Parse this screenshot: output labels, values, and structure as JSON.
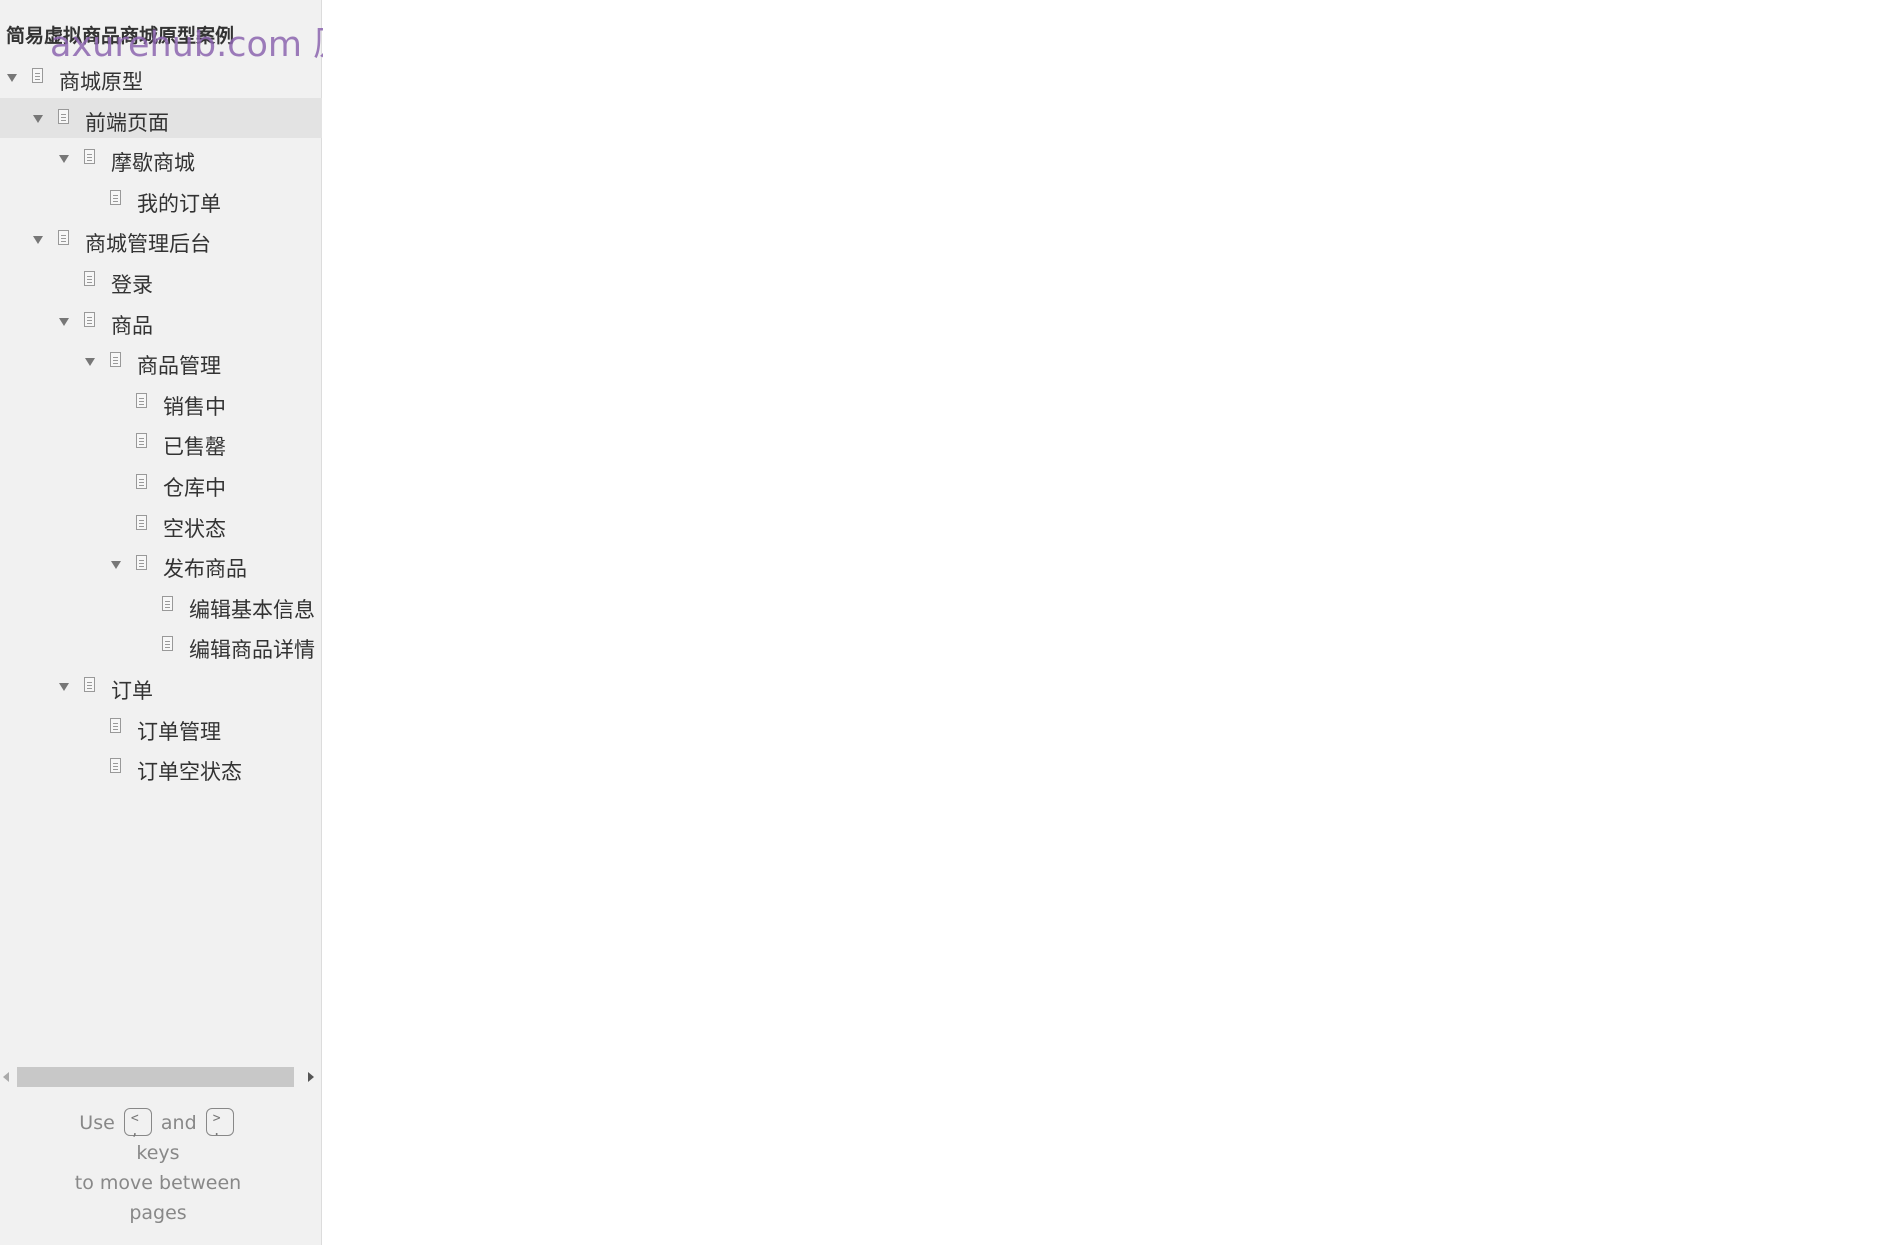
{
  "project": {
    "title": "简易虚拟商品商城原型案例",
    "watermark": "axurehub.com 原型资源站"
  },
  "tree": [
    {
      "label": "商城原型",
      "level": 0,
      "expanded": true,
      "selected": false
    },
    {
      "label": "前端页面",
      "level": 1,
      "expanded": true,
      "selected": true
    },
    {
      "label": "摩歇商城",
      "level": 2,
      "expanded": true,
      "selected": false
    },
    {
      "label": "我的订单",
      "level": 3,
      "expanded": false,
      "selected": false
    },
    {
      "label": "商城管理后台",
      "level": 1,
      "expanded": true,
      "selected": false
    },
    {
      "label": "登录",
      "level": 2,
      "expanded": false,
      "selected": false
    },
    {
      "label": "商品",
      "level": 2,
      "expanded": true,
      "selected": false
    },
    {
      "label": "商品管理",
      "level": 3,
      "expanded": true,
      "selected": false
    },
    {
      "label": "销售中",
      "level": 4,
      "expanded": false,
      "selected": false
    },
    {
      "label": "已售罄",
      "level": 4,
      "expanded": false,
      "selected": false
    },
    {
      "label": "仓库中",
      "level": 4,
      "expanded": false,
      "selected": false
    },
    {
      "label": "空状态",
      "level": 4,
      "expanded": false,
      "selected": false
    },
    {
      "label": "发布商品",
      "level": 4,
      "expanded": true,
      "selected": false
    },
    {
      "label": "编辑基本信息",
      "level": 5,
      "expanded": false,
      "selected": false
    },
    {
      "label": "编辑商品详情",
      "level": 5,
      "expanded": false,
      "selected": false
    },
    {
      "label": "订单",
      "level": 2,
      "expanded": true,
      "selected": false
    },
    {
      "label": "订单管理",
      "level": 3,
      "expanded": false,
      "selected": false
    },
    {
      "label": "订单空状态",
      "level": 3,
      "expanded": false,
      "selected": false
    }
  ],
  "help": {
    "use": "Use",
    "key_prev": "<\n,",
    "and": "and",
    "key_next": ">\n.",
    "keys": "keys",
    "line2": "to move between",
    "line3": "pages"
  },
  "icons": {
    "expand": "triangle-down-icon",
    "page": "page-icon",
    "scroll_left": "scroll-left-icon",
    "scroll_right": "scroll-right-icon"
  }
}
